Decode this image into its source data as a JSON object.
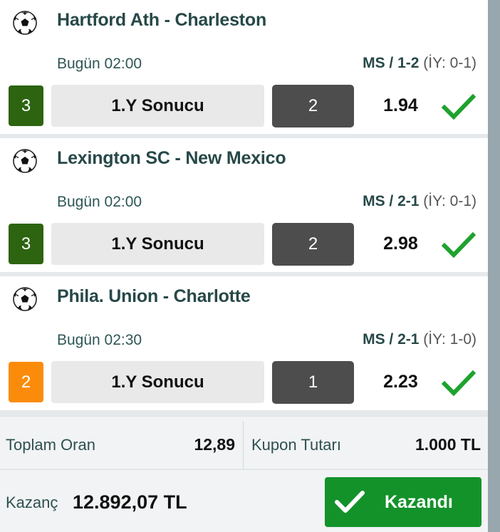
{
  "colors": {
    "success": "#14922a",
    "badge_green": "#2c6410",
    "badge_orange": "#fb8c0b",
    "pick_bg": "#4d4d4d",
    "tick": "#1fa22e"
  },
  "matches": [
    {
      "teams": "Hartford Ath - Charleston",
      "time": "Bugün 02:00",
      "result_prefix": "MS / 1-2",
      "result_ht": "(İY: 0-1)",
      "badge": "3",
      "badge_color": "green",
      "market": "1.Y Sonucu",
      "pick": "2",
      "odd": "1.94",
      "status_icon": "check-icon"
    },
    {
      "teams": "Lexington SC - New Mexico",
      "time": "Bugün 02:00",
      "result_prefix": "MS / 2-1",
      "result_ht": "(İY: 0-1)",
      "badge": "3",
      "badge_color": "green",
      "market": "1.Y Sonucu",
      "pick": "2",
      "odd": "2.98",
      "status_icon": "check-icon"
    },
    {
      "teams": "Phila. Union - Charlotte",
      "time": "Bugün 02:30",
      "result_prefix": "MS / 2-1",
      "result_ht": "(İY: 1-0)",
      "badge": "2",
      "badge_color": "orange",
      "market": "1.Y Sonucu",
      "pick": "1",
      "odd": "2.23",
      "status_icon": "check-icon"
    }
  ],
  "summary": {
    "total_odds_label": "Toplam Oran",
    "total_odds_value": "12,89",
    "stake_label": "Kupon Tutarı",
    "stake_value": "1.000 TL",
    "winnings_label": "Kazanç",
    "winnings_value": "12.892,07 TL",
    "status_button": "Kazandı"
  }
}
